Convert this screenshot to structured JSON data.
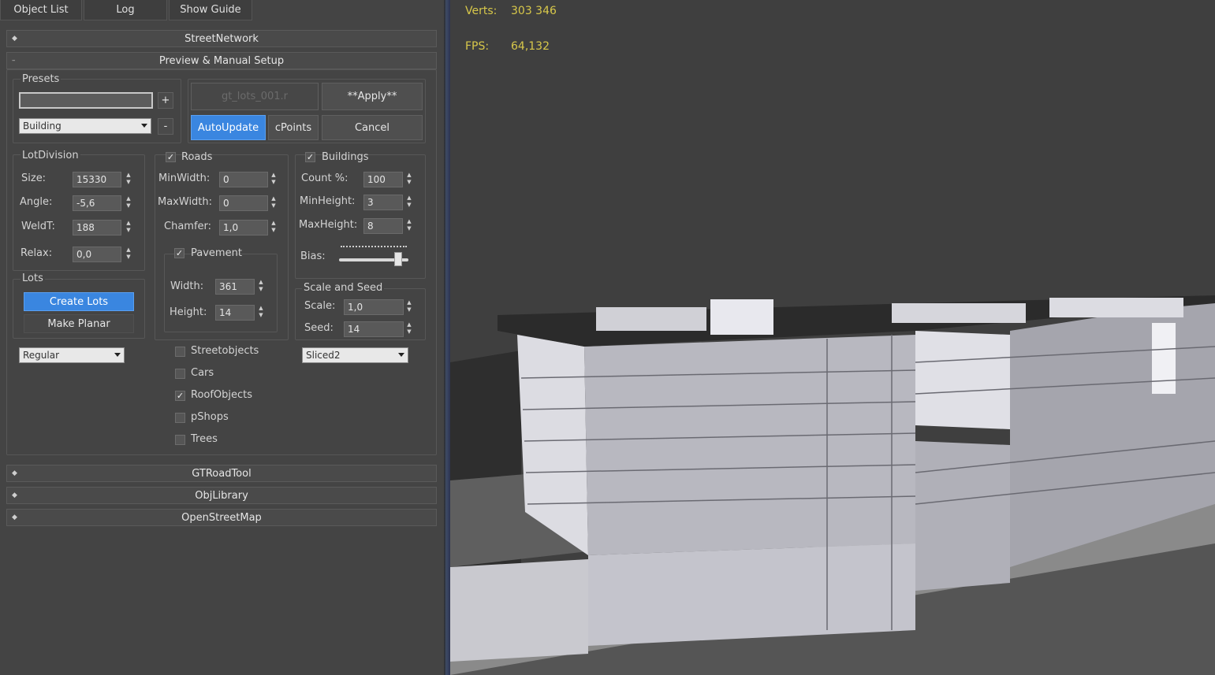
{
  "tabs": [
    "Object List",
    "Log",
    "Show Guide"
  ],
  "rollouts": {
    "street_network": "StreetNetwork",
    "preview": "Preview & Manual Setup",
    "gt_road_tool": "GTRoadTool",
    "obj_library": "ObjLibrary",
    "open_street_map": "OpenStreetMap"
  },
  "presets": {
    "title": "Presets",
    "name_value": "",
    "add": "+",
    "remove": "-",
    "type_select": "Building"
  },
  "actions": {
    "disabled_label": "gt_lots_001.r",
    "apply": "**Apply**",
    "autoupdate": "AutoUpdate",
    "cpoints": "cPoints",
    "cancel": "Cancel"
  },
  "lot_division": {
    "title": "LotDivision",
    "size_label": "Size:",
    "size": "15330",
    "angle_label": "Angle:",
    "angle": "-5,6",
    "weldt_label": "WeldT:",
    "weldt": "188",
    "relax_label": "Relax:",
    "relax": "0,0"
  },
  "lots": {
    "title": "Lots",
    "create": "Create Lots",
    "make_planar": "Make Planar",
    "mode_select": "Regular"
  },
  "roads": {
    "title": "Roads",
    "checked": true,
    "minwidth_label": "MinWidth:",
    "minwidth": "0",
    "maxwidth_label": "MaxWidth:",
    "maxwidth": "0",
    "chamfer_label": "Chamfer:",
    "chamfer": "1,0"
  },
  "pavement": {
    "title": "Pavement",
    "checked": true,
    "width_label": "Width:",
    "width": "361",
    "height_label": "Height:",
    "height": "14"
  },
  "buildings": {
    "title": "Buildings",
    "checked": true,
    "count_label": "Count %:",
    "count": "100",
    "minheight_label": "MinHeight:",
    "minheight": "3",
    "maxheight_label": "MaxHeight:",
    "maxheight": "8",
    "bias_label": "Bias:",
    "bias_level": 0.85
  },
  "scale_seed": {
    "title": "Scale and Seed",
    "scale_label": "Scale:",
    "scale": "1,0",
    "seed_label": "Seed:",
    "seed": "14",
    "style_select": "Sliced2"
  },
  "options": [
    {
      "label": "Streetobjects",
      "checked": false
    },
    {
      "label": "Cars",
      "checked": false
    },
    {
      "label": "RoofObjects",
      "checked": true
    },
    {
      "label": "pShops",
      "checked": false
    },
    {
      "label": "Trees",
      "checked": false
    }
  ],
  "hud": {
    "verts_label": "Verts:",
    "verts": "303 346",
    "fps_label": "FPS:",
    "fps": "64,132"
  },
  "colors": {
    "accent": "#3a86e0",
    "panel": "#444444",
    "hud_text": "#d8c84a"
  }
}
